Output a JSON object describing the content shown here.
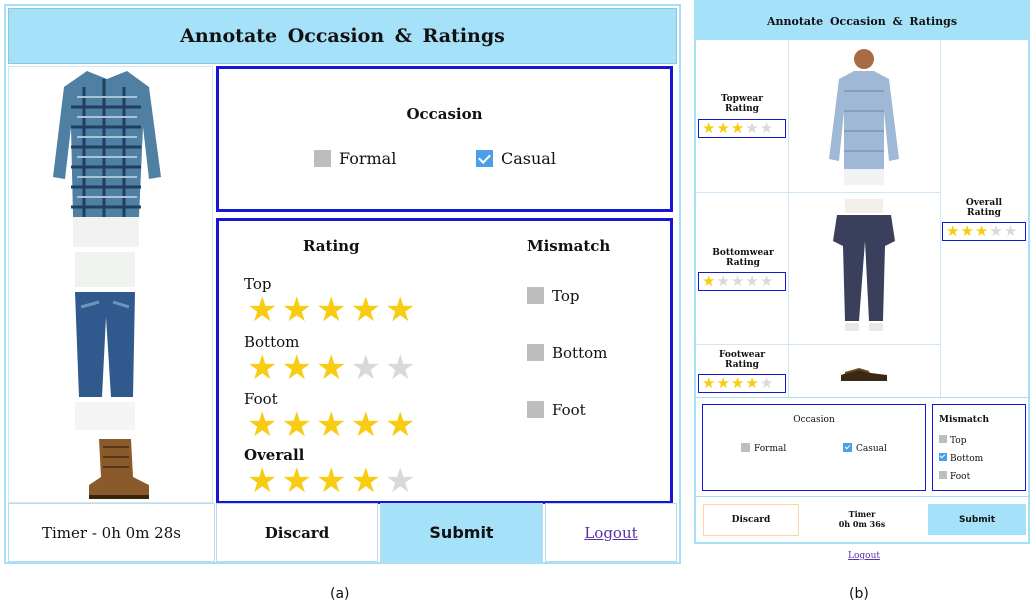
{
  "panel_a": {
    "title": "Annotate Occasion & Ratings",
    "occasion": {
      "heading": "Occasion",
      "options": [
        {
          "label": "Formal",
          "checked": false
        },
        {
          "label": "Casual",
          "checked": true
        }
      ]
    },
    "rating_heading": "Rating",
    "mismatch_heading": "Mismatch",
    "ratings": [
      {
        "label": "Top",
        "stars": 5
      },
      {
        "label": "Bottom",
        "stars": 3
      },
      {
        "label": "Foot",
        "stars": 5
      },
      {
        "label": "Overall",
        "stars": 4
      }
    ],
    "mismatch": [
      {
        "label": "Top",
        "checked": false
      },
      {
        "label": "Bottom",
        "checked": false
      },
      {
        "label": "Foot",
        "checked": false
      }
    ],
    "timer": "Timer - 0h 0m 28s",
    "discard": "Discard",
    "submit": "Submit",
    "logout": "Logout"
  },
  "panel_b": {
    "title": "Annotate Occasion & Ratings",
    "topwear": {
      "label": "Topwear Rating",
      "stars": 3
    },
    "bottomwear": {
      "label": "Bottomwear Rating",
      "stars": 1
    },
    "footwear": {
      "label": "Footwear Rating",
      "stars": 4
    },
    "overall": {
      "label": "Overall Rating",
      "stars": 3
    },
    "occasion": {
      "heading": "Occasion",
      "options": [
        {
          "label": "Formal",
          "checked": false
        },
        {
          "label": "Casual",
          "checked": true
        }
      ]
    },
    "mismatch": {
      "heading": "Mismatch",
      "items": [
        {
          "label": "Top",
          "checked": false
        },
        {
          "label": "Bottom",
          "checked": true
        },
        {
          "label": "Foot",
          "checked": false
        }
      ]
    },
    "discard": "Discard",
    "timer_label": "Timer",
    "timer_value": "0h 0m 36s",
    "submit": "Submit",
    "logout": "Logout"
  },
  "captions": {
    "a": "(a)",
    "b": "(b)"
  },
  "colors": {
    "header": "#a6e1fa",
    "star": "#f7cc12",
    "border": "#1616d6",
    "check": "#4a9fe8"
  },
  "star_total": 5
}
